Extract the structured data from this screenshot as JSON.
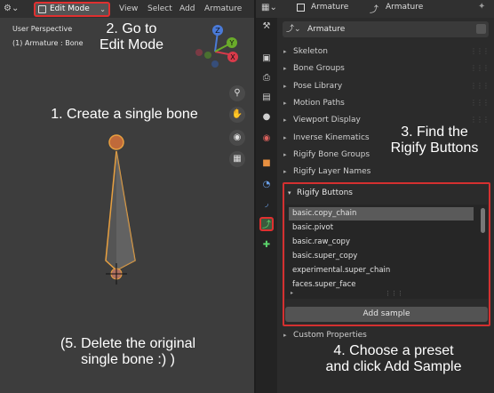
{
  "viewport": {
    "editor_type_icon": "armature-pose-icon",
    "mode_select": "Edit Mode",
    "menu": [
      "View",
      "Select",
      "Add",
      "Armature"
    ],
    "overlay_line1": "User Perspective",
    "overlay_line2": "(1) Armature : Bone",
    "gizmo_labels": {
      "z": "Z",
      "y": "Y",
      "x": "X"
    },
    "nav_tools": [
      "zoom-icon",
      "pan-hand-icon",
      "camera-icon",
      "grid-icon"
    ]
  },
  "annotations": {
    "step2": "2. Go to\nEdit Mode",
    "step1": "1. Create a single bone",
    "step5": "(5. Delete the original\nsingle bone :) )",
    "step3": "3. Find the\nRigify Buttons",
    "step4": "4. Choose a preset\nand click Add Sample"
  },
  "properties": {
    "header_context": "Armature",
    "header_object": "Armature",
    "search_value": "Armature",
    "panels": [
      "Skeleton",
      "Bone Groups",
      "Pose Library",
      "Motion Paths",
      "Viewport Display",
      "Inverse Kinematics",
      "Rigify Bone Groups",
      "Rigify Layer Names"
    ],
    "rigify_panel": "Rigify Buttons",
    "samples": [
      "basic.copy_chain",
      "basic.pivot",
      "basic.raw_copy",
      "basic.super_copy",
      "experimental.super_chain",
      "faces.super_face"
    ],
    "selected_sample": "basic.copy_chain",
    "add_sample_label": "Add sample",
    "custom_properties": "Custom Properties"
  },
  "colors": {
    "highlight_red": "#e03030",
    "selected_tab_green": "#5bd36b",
    "bone_orange": "#e8a040"
  }
}
